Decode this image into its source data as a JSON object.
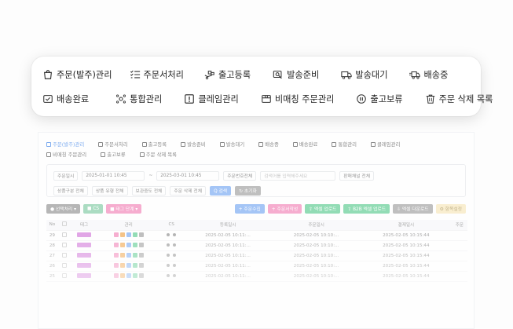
{
  "menu": {
    "row1": [
      {
        "label": "주문(발주)관리",
        "icon": "shopping-bag-icon"
      },
      {
        "label": "주문서처리",
        "icon": "checklist-icon"
      },
      {
        "label": "출고등록",
        "icon": "hand-truck-icon"
      },
      {
        "label": "발송준비",
        "icon": "package-search-icon"
      },
      {
        "label": "발송대기",
        "icon": "truck-icon"
      },
      {
        "label": "배송중",
        "icon": "delivery-truck-icon"
      }
    ],
    "row2": [
      {
        "label": "배송완료",
        "icon": "box-check-icon"
      },
      {
        "label": "통합관리",
        "icon": "network-icon"
      },
      {
        "label": "클레임관리",
        "icon": "alert-box-icon"
      },
      {
        "label": "비매칭 주문관리",
        "icon": "box-icon"
      },
      {
        "label": "출고보류",
        "icon": "pause-circle-icon"
      },
      {
        "label": "주문 삭제 목록",
        "icon": "trash-icon"
      }
    ]
  },
  "app": {
    "tabs_row1": [
      "주문(발주)관리",
      "주문서처리",
      "출고등록",
      "발송준비",
      "발송대기",
      "배송중",
      "배송완료",
      "통합관리",
      "클레임관리"
    ],
    "tabs_row2": [
      "비매칭 주문관리",
      "출고보류",
      "주문 삭제 목록"
    ],
    "filters": {
      "date_type": "주문일시",
      "date_from": "2025-01-01 10:45",
      "date_to": "2025-03-01 10:45",
      "search_type": "주문번호전체",
      "search_placeholder": "검색어를 입력해주세요",
      "channel": "판매채널 전체",
      "product_type": "상품구분 전체",
      "product_category": "상품 유형 전체",
      "hold_state": "보관중도 전체",
      "delete_state": "주문 삭제 전체",
      "search_btn": "Q 검색",
      "reset_btn": "↻ 초기화"
    },
    "actions": {
      "batch": "● 선택처리 ▾",
      "cs": "■ CS",
      "tag": "■ 태그 단계 ▾",
      "collect": "+ 주문수집",
      "write": "+ 주문서작성",
      "excel_upload": "⇪ 엑셀 업로드",
      "b2b_upload": "⇪ B2B 엑셀 업로드",
      "excel_download": "⇩ 엑셀 다운로드",
      "settings": "⚙ 항목설정"
    },
    "table_headers": [
      "No",
      "",
      "태그",
      "관리",
      "CS",
      "등록일시",
      "주문일시",
      "결제일시",
      "주문"
    ],
    "rows": [
      {
        "no": "29",
        "reg": "2025-02-05 10:11:...",
        "order": "2025-02-05 10:10:...",
        "pay": "2025-02-05 10:15:44"
      },
      {
        "no": "28",
        "reg": "2025-02-05 10:11:...",
        "order": "2025-02-05 10:10:...",
        "pay": "2025-02-05 10:15:44"
      },
      {
        "no": "27",
        "reg": "2025-02-05 10:11:...",
        "order": "2025-02-05 10:10:...",
        "pay": "2025-02-05 10:15:44"
      },
      {
        "no": "26",
        "reg": "2025-02-05 10:11:...",
        "order": "2025-02-05 10:10:...",
        "pay": "2025-02-05 10:15:44"
      },
      {
        "no": "25",
        "reg": "2025-02-05 10:11:...",
        "order": "2025-02-05 10:10:...",
        "pay": "2025-02-05 10:15:44"
      }
    ]
  },
  "colors": {
    "accent": "#2f79e8",
    "pink": "#f27db4",
    "green": "#52c98a",
    "grey": "#8c8c8c",
    "tag": "#d070d8"
  }
}
